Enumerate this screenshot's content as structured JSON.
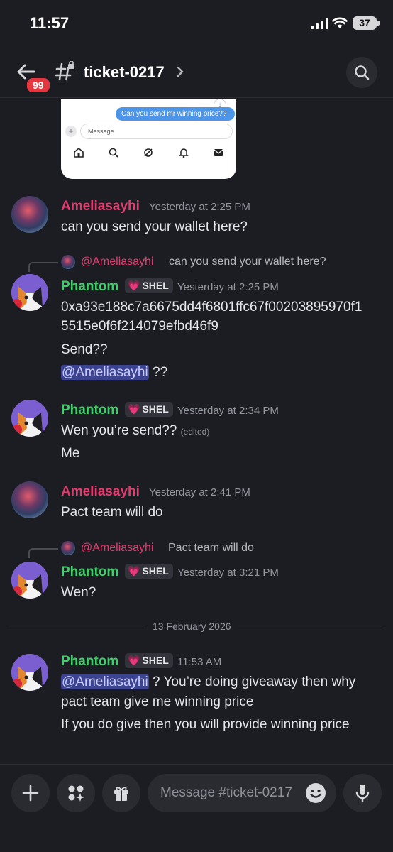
{
  "status_bar": {
    "time": "11:57",
    "battery": "37"
  },
  "header": {
    "channel_name": "ticket-0217",
    "unread_count": "99"
  },
  "attachment": {
    "bubble_text": "Can you send mr winning price??",
    "input_placeholder": "Message"
  },
  "messages": [
    {
      "author": "Ameliasayhi",
      "timestamp": "Yesterday at 2:25 PM",
      "lines": [
        "can you send your wallet here?"
      ]
    },
    {
      "reply_to": {
        "author": "@Ameliasayhi",
        "text": "can you send your wallet here?"
      },
      "author": "Phantom",
      "tag": "SHEL",
      "timestamp": "Yesterday at 2:25 PM",
      "lines": [
        "0xa93e188c7a6675dd4f6801ffc67f00203895970f1",
        "5515e0f6f214079efbd46f9",
        "Send??"
      ],
      "mention_line": {
        "mention": "@Ameliasayhi",
        "rest": " ??"
      }
    },
    {
      "author": "Phantom",
      "tag": "SHEL",
      "timestamp": "Yesterday at 2:34 PM",
      "lines": [
        "Wen you’re send??",
        "Me"
      ],
      "edited": "(edited)"
    },
    {
      "author": "Ameliasayhi",
      "timestamp": "Yesterday at 2:41 PM",
      "lines": [
        "Pact team will do"
      ]
    },
    {
      "reply_to": {
        "author": "@Ameliasayhi",
        "text": "Pact team will do"
      },
      "author": "Phantom",
      "tag": "SHEL",
      "timestamp": "Yesterday at 3:21 PM",
      "lines": [
        "Wen?"
      ]
    },
    {
      "author": "Phantom",
      "tag": "SHEL",
      "timestamp": "11:53 AM",
      "mention_line": {
        "mention": "@Ameliasayhi",
        "rest": " ? You’re doing giveaway then why"
      },
      "lines": [
        "pact team give me winning price",
        "If you do give then you will provide winning price"
      ]
    }
  ],
  "date_divider": "13 February 2026",
  "composer": {
    "placeholder": "Message #ticket-0217"
  },
  "colors": {
    "background": "#1c1d22",
    "amelia": "#e23c6f",
    "phantom": "#3fcf6a",
    "mention_bg": "#3c4391",
    "badge": "#e3363e"
  }
}
